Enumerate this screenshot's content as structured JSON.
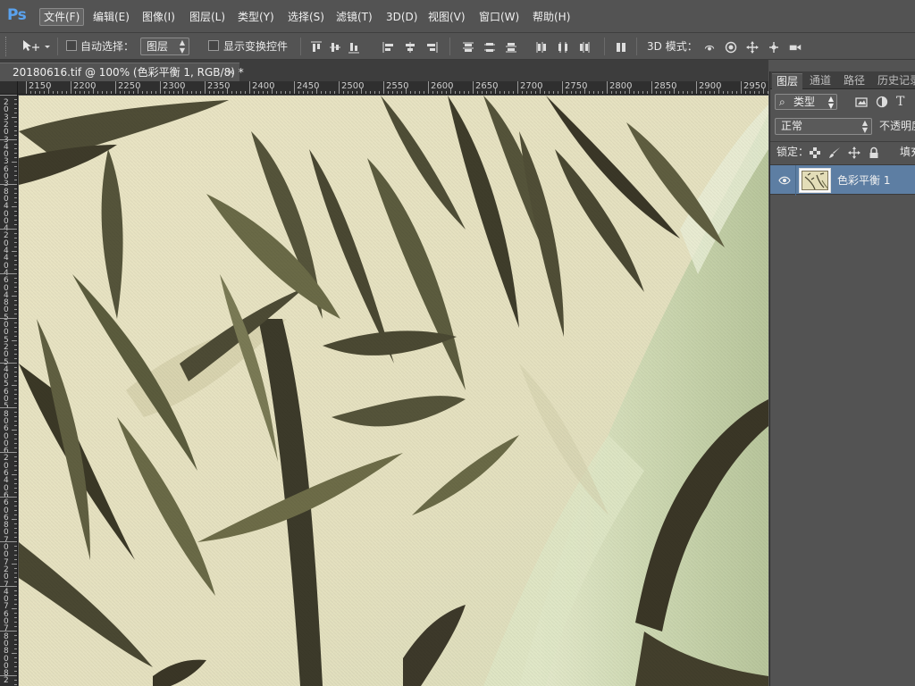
{
  "app": {
    "logo": "Ps"
  },
  "menu": {
    "items": [
      {
        "label": "文件(F)",
        "active": true
      },
      {
        "label": "编辑(E)"
      },
      {
        "label": "图像(I)"
      },
      {
        "label": "图层(L)"
      },
      {
        "label": "类型(Y)"
      },
      {
        "label": "选择(S)"
      },
      {
        "label": "滤镜(T)"
      },
      {
        "label": "3D(D)"
      },
      {
        "label": "视图(V)"
      },
      {
        "label": "窗口(W)"
      },
      {
        "label": "帮助(H)"
      }
    ]
  },
  "options": {
    "auto_select_label": "自动选择：",
    "auto_select_target": "图层",
    "show_transform_label": "显示变换控件",
    "mode_3d_label": "3D 模式："
  },
  "document": {
    "tab_title": "20180616.tif @ 100% (色彩平衡 1, RGB/8) *",
    "close_glyph": "×"
  },
  "rulers": {
    "top_labels": [
      "2150",
      "2200",
      "2250",
      "2300",
      "2350",
      "2400",
      "2450",
      "2500",
      "2550",
      "2600",
      "2650",
      "2700",
      "2750",
      "2800",
      "2850",
      "2900",
      "2950"
    ],
    "left_digits": [
      "2",
      "0",
      "3",
      "2",
      "0",
      "3",
      "4",
      "0",
      "3",
      "6",
      "0",
      "3",
      "8",
      "0",
      "4",
      "0",
      "0",
      "4",
      "2",
      "0",
      "4",
      "4",
      "0",
      "4",
      "6",
      "0",
      "4",
      "8",
      "0",
      "5",
      "0",
      "0",
      "5",
      "2",
      "0",
      "5",
      "4",
      "0",
      "5",
      "6",
      "0",
      "5",
      "8",
      "0",
      "6",
      "0",
      "0",
      "6",
      "2",
      "0",
      "6",
      "4",
      "0",
      "6",
      "6",
      "0",
      "6",
      "8",
      "0",
      "7",
      "0",
      "0",
      "7",
      "2",
      "0",
      "7",
      "4",
      "0",
      "7",
      "6",
      "0",
      "7",
      "8",
      "0",
      "8",
      "0",
      "0",
      "8",
      "2",
      "0",
      "8",
      "4",
      "0"
    ]
  },
  "layers_panel": {
    "tabs": [
      "图层",
      "通道",
      "路径",
      "历史记录"
    ],
    "filter_label": "类型",
    "blend_mode": "正常",
    "opacity_label": "不透明度",
    "lock_label": "锁定：",
    "fill_label": "填充",
    "layers": [
      {
        "name": "色彩平衡 1",
        "visible": true,
        "selected": true
      }
    ]
  },
  "colors": {
    "chrome": "#535353",
    "selected_layer": "#5d7ea3",
    "ps_blue": "#5aa2ee",
    "canvas_bg": "#e6e1c2"
  },
  "icons": [
    "move-tool-icon",
    "checkbox",
    "align-icons",
    "3d-icons",
    "search-icon",
    "image-filter-icon",
    "adjust-filter-icon",
    "text-filter-icon",
    "lock-pixels-icon",
    "lock-brush-icon",
    "lock-move-icon",
    "lock-all-icon",
    "eye-icon"
  ]
}
